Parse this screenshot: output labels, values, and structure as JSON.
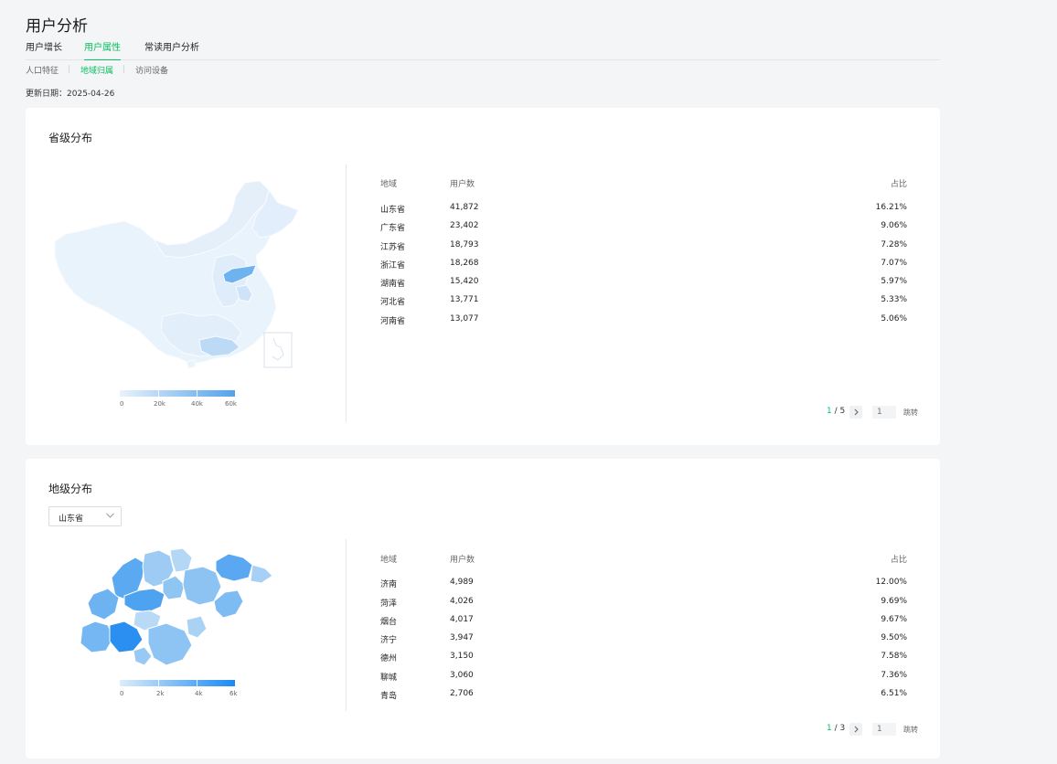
{
  "page": {
    "title": "用户分析"
  },
  "tabs": [
    {
      "label": "用户增长",
      "active": false
    },
    {
      "label": "用户属性",
      "active": true
    },
    {
      "label": "常读用户分析",
      "active": false
    }
  ],
  "subtabs": [
    {
      "label": "人口特征",
      "active": false
    },
    {
      "label": "地域归属",
      "active": true
    },
    {
      "label": "访问设备",
      "active": false
    }
  ],
  "update": {
    "label": "更新日期：",
    "date": "2025-04-26"
  },
  "colors": {
    "accent": "#07c160",
    "map_light": "#e8f2fc",
    "map_mid": "#aad3f5",
    "map_dark": "#2f8ff0"
  },
  "province": {
    "title": "省级分布",
    "headers": {
      "region": "地域",
      "users": "用户数",
      "ratio": "占比"
    },
    "rows": [
      {
        "region": "山东省",
        "users": "41,872",
        "ratio": "16.21%"
      },
      {
        "region": "广东省",
        "users": "23,402",
        "ratio": "9.06%"
      },
      {
        "region": "江苏省",
        "users": "18,793",
        "ratio": "7.28%"
      },
      {
        "region": "浙江省",
        "users": "18,268",
        "ratio": "7.07%"
      },
      {
        "region": "湖南省",
        "users": "15,420",
        "ratio": "5.97%"
      },
      {
        "region": "河北省",
        "users": "13,771",
        "ratio": "5.33%"
      },
      {
        "region": "河南省",
        "users": "13,077",
        "ratio": "5.06%"
      }
    ],
    "legend": [
      "0",
      "20k",
      "40k",
      "60k"
    ],
    "pager": {
      "current": "1",
      "sep": " / ",
      "total": "5",
      "input_placeholder": "1",
      "jump": "跳转"
    }
  },
  "city": {
    "title": "地级分布",
    "select": {
      "value": "山东省"
    },
    "headers": {
      "region": "地域",
      "users": "用户数",
      "ratio": "占比"
    },
    "rows": [
      {
        "region": "济南",
        "users": "4,989",
        "ratio": "12.00%"
      },
      {
        "region": "菏泽",
        "users": "4,026",
        "ratio": "9.69%"
      },
      {
        "region": "烟台",
        "users": "4,017",
        "ratio": "9.67%"
      },
      {
        "region": "济宁",
        "users": "3,947",
        "ratio": "9.50%"
      },
      {
        "region": "德州",
        "users": "3,150",
        "ratio": "7.58%"
      },
      {
        "region": "聊城",
        "users": "3,060",
        "ratio": "7.36%"
      },
      {
        "region": "青岛",
        "users": "2,706",
        "ratio": "6.51%"
      }
    ],
    "legend": [
      "0",
      "2k",
      "4k",
      "6k"
    ],
    "pager": {
      "current": "1",
      "sep": " / ",
      "total": "3",
      "input_placeholder": "1",
      "jump": "跳转"
    }
  }
}
